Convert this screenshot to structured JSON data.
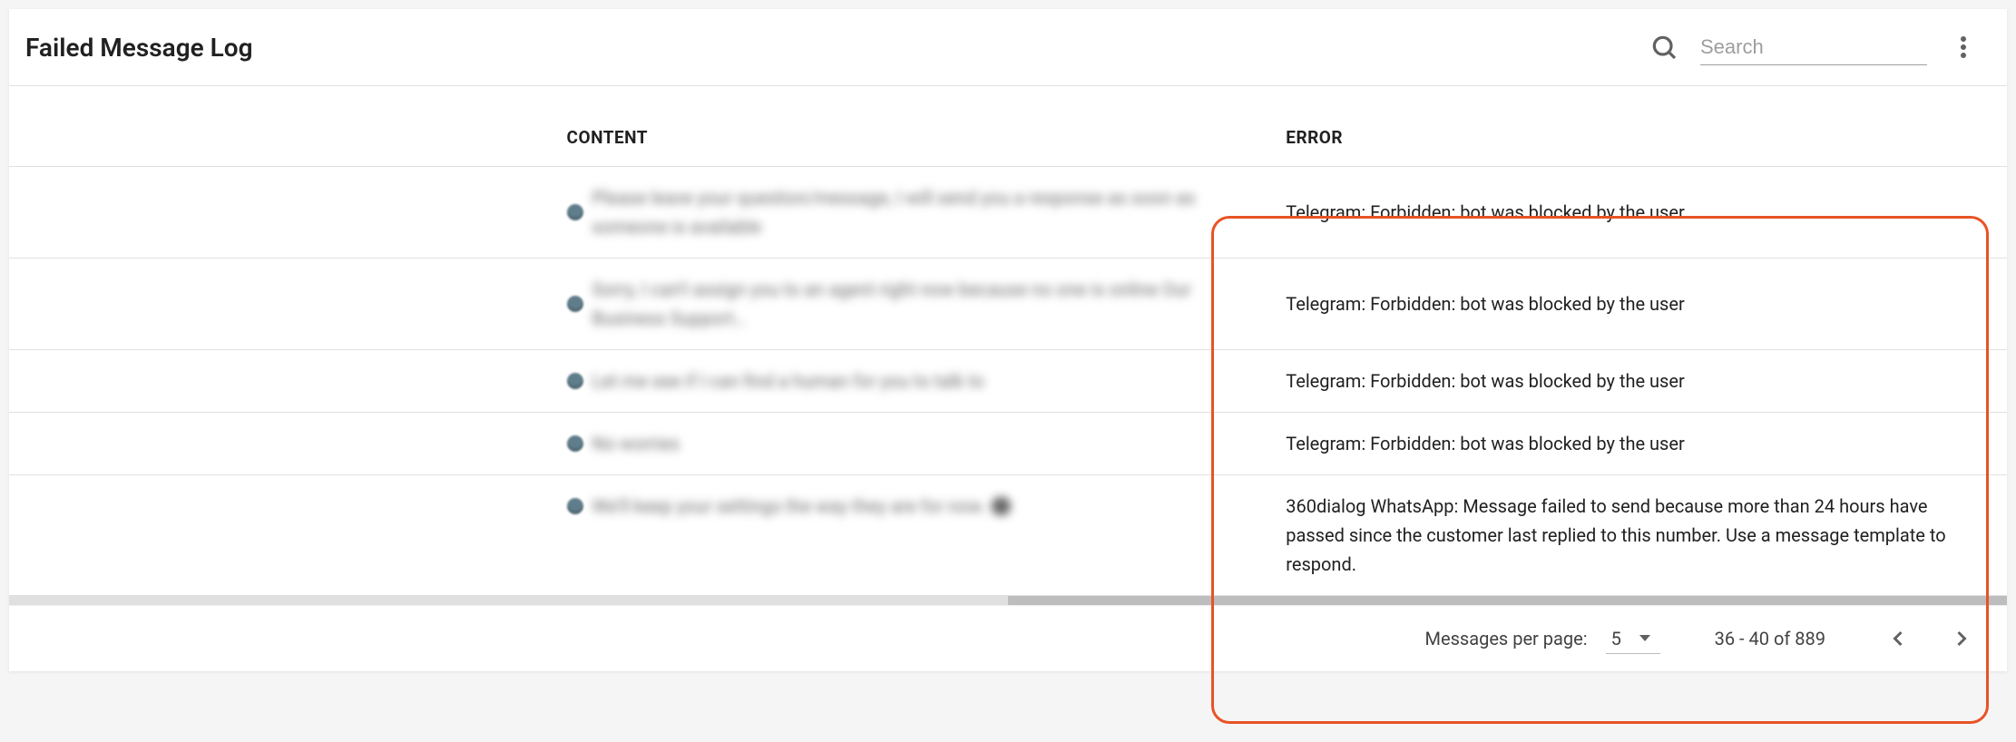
{
  "header": {
    "title": "Failed Message Log",
    "search_placeholder": "Search"
  },
  "columns": {
    "content": "CONTENT",
    "error": "ERROR"
  },
  "rows": [
    {
      "content": "Please leave your question/message, I will send you a response as soon as someone is available",
      "error": "Telegram: Forbidden: bot was blocked by the user"
    },
    {
      "content": "Sorry, I can't assign you to an agent right now because no one is online Our Business Support…",
      "error": "Telegram: Forbidden: bot was blocked by the user"
    },
    {
      "content": "Let me see if I can find a human for you to talk to",
      "error": "Telegram: Forbidden: bot was blocked by the user"
    },
    {
      "content": "No worries",
      "error": "Telegram: Forbidden: bot was blocked by the user"
    },
    {
      "content": "We'll keep your settings the way they are for now. 🙂",
      "error": "360dialog WhatsApp: Message failed to send because more than 24 hours have passed since the customer last replied to this number. Use a message template to respond."
    }
  ],
  "pagination": {
    "per_page_label": "Messages per page:",
    "per_page_value": "5",
    "range": "36 - 40 of 889"
  }
}
